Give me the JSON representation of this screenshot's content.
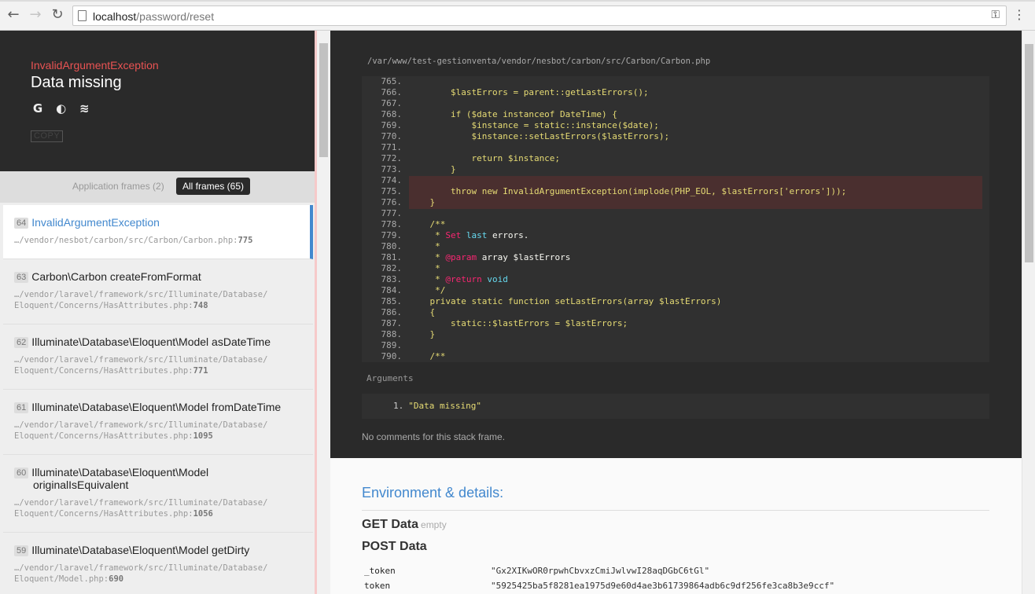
{
  "browser": {
    "back_icon": "←",
    "forward_icon": "→",
    "reload_icon": "↻",
    "url_host": "localhost",
    "url_path": "/password/reset",
    "key_icon": "⚿",
    "menu_icon": "⋮"
  },
  "exception": {
    "class": "InvalidArgumentException",
    "message": "Data missing",
    "search_icons": [
      "G",
      "◐",
      "≋"
    ],
    "copy_label": "COPY"
  },
  "frames_tabs": {
    "application": "Application frames (2)",
    "all": "All frames (65)"
  },
  "frames": [
    {
      "index": "64",
      "class": "InvalidArgumentException",
      "file": "…/vendor/nesbot/carbon/src/Carbon/Carbon.php",
      "line": "775"
    },
    {
      "index": "63",
      "class": "Carbon\\Carbon createFromFormat",
      "file": "…/vendor/laravel/framework/src/Illuminate/Database/",
      "file2": "Eloquent/Concerns/HasAttributes.php",
      "line": "748"
    },
    {
      "index": "62",
      "class": "Illuminate\\Database\\Eloquent\\Model asDateTime",
      "file": "…/vendor/laravel/framework/src/Illuminate/Database/",
      "file2": "Eloquent/Concerns/HasAttributes.php",
      "line": "771"
    },
    {
      "index": "61",
      "class": "Illuminate\\Database\\Eloquent\\Model fromDateTime",
      "file": "…/vendor/laravel/framework/src/Illuminate/Database/",
      "file2": "Eloquent/Concerns/HasAttributes.php",
      "line": "1095"
    },
    {
      "index": "60",
      "class": "Illuminate\\Database\\Eloquent\\Model",
      "class2": "originalIsEquivalent",
      "file": "…/vendor/laravel/framework/src/Illuminate/Database/",
      "file2": "Eloquent/Concerns/HasAttributes.php",
      "line": "1056"
    },
    {
      "index": "59",
      "class": "Illuminate\\Database\\Eloquent\\Model getDirty",
      "file": "…/vendor/laravel/framework/src/Illuminate/Database/",
      "file2": "Eloquent/Model.php",
      "line": "690"
    }
  ],
  "code": {
    "file_path": "/var/www/test-gestionventa/vendor/nesbot/carbon/src/Carbon/Carbon.php",
    "lines": [
      {
        "n": "765.",
        "t": ""
      },
      {
        "n": "766.",
        "t": "        $lastErrors = parent::getLastErrors();"
      },
      {
        "n": "767.",
        "t": ""
      },
      {
        "n": "768.",
        "t": "        if ($date instanceof DateTime) {"
      },
      {
        "n": "769.",
        "t": "            $instance = static::instance($date);"
      },
      {
        "n": "770.",
        "t": "            $instance::setLastErrors($lastErrors);"
      },
      {
        "n": "771.",
        "t": ""
      },
      {
        "n": "772.",
        "t": "            return $instance;"
      },
      {
        "n": "773.",
        "t": "        }"
      },
      {
        "n": "774.",
        "t": ""
      },
      {
        "n": "775.",
        "t": "        throw new InvalidArgumentException(implode(PHP_EOL, $lastErrors['errors']));"
      },
      {
        "n": "776.",
        "t": "    }"
      },
      {
        "n": "777.",
        "t": ""
      },
      {
        "n": "778.",
        "t": "    /**"
      },
      {
        "n": "779.",
        "t": "     * Set last errors."
      },
      {
        "n": "780.",
        "t": "     *"
      },
      {
        "n": "781.",
        "t": "     * @param array $lastErrors"
      },
      {
        "n": "782.",
        "t": "     *"
      },
      {
        "n": "783.",
        "t": "     * @return void"
      },
      {
        "n": "784.",
        "t": "     */"
      },
      {
        "n": "785.",
        "t": "    private static function setLastErrors(array $lastErrors)"
      },
      {
        "n": "786.",
        "t": "    {"
      },
      {
        "n": "787.",
        "t": "        static::$lastErrors = $lastErrors;"
      },
      {
        "n": "788.",
        "t": "    }"
      },
      {
        "n": "789.",
        "t": ""
      },
      {
        "n": "790.",
        "t": "    /**"
      }
    ],
    "highlight_line": "775."
  },
  "arguments": {
    "label": "Arguments",
    "items": [
      {
        "num": "1.",
        "value": "\"Data missing\""
      }
    ]
  },
  "no_comments": "No comments for this stack frame.",
  "environment": {
    "title": "Environment & details:",
    "get_label": "GET Data",
    "get_empty": "empty",
    "post_label": "POST Data",
    "post": [
      {
        "key": "_token",
        "value": "\"Gx2XIKwOR0rpwhCbvxzCmiJwlvwI28aqDGbC6tGl\""
      },
      {
        "key": "token",
        "value": "\"5925425ba5f8281ea1975d9e60d4ae3b61739864adb6c9df256fe3ca8b3e9ccf\""
      }
    ]
  }
}
